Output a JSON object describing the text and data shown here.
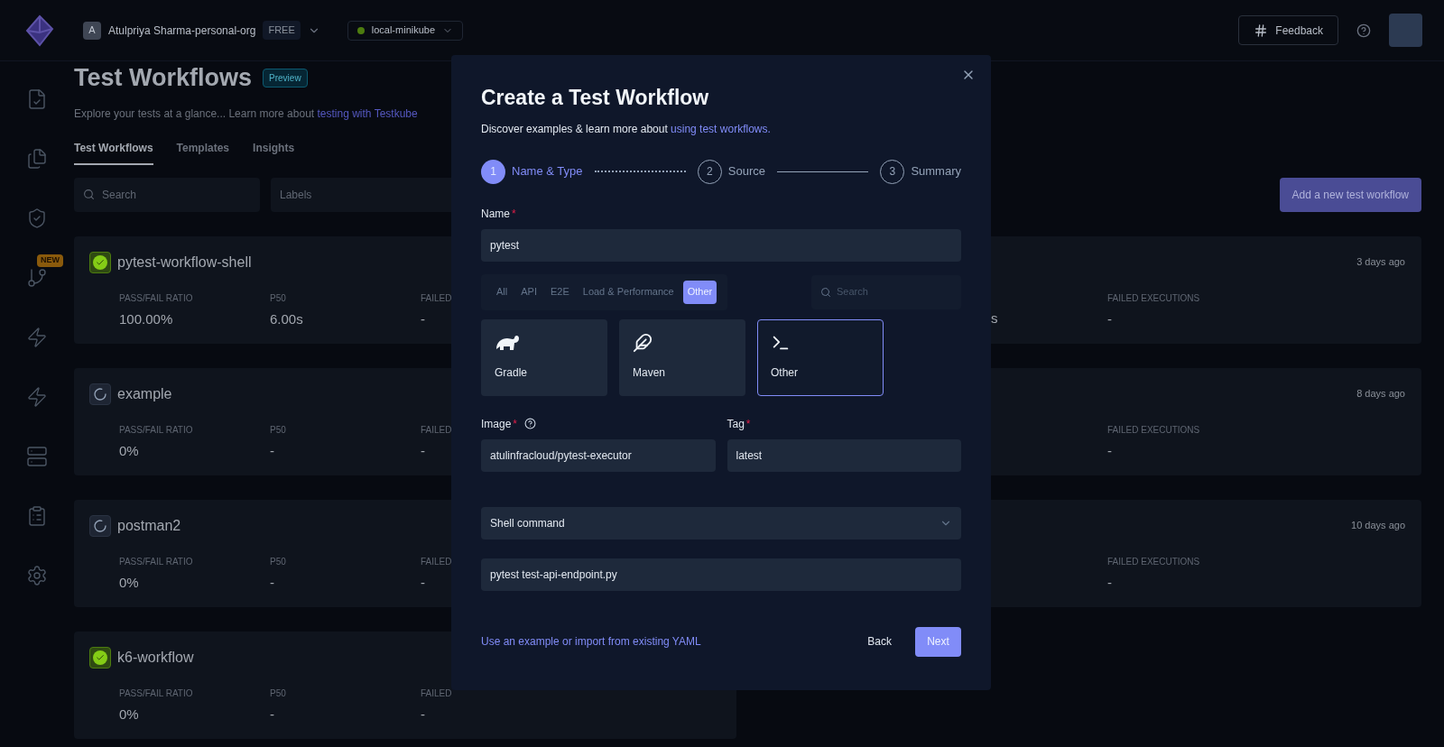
{
  "topbar": {
    "org": {
      "initial": "A",
      "name": "Atulpriya Sharma-personal-org",
      "plan": "FREE"
    },
    "environment": {
      "name": "local-minikube"
    },
    "feedback": "Feedback"
  },
  "sidebar": {
    "badge": "NEW"
  },
  "page": {
    "title": "Test Workflows",
    "badge": "Preview",
    "description": "Explore your tests at a glance... Learn more about ",
    "description_link": "testing with Testkube",
    "tabs": [
      {
        "label": "Test Workflows",
        "selected": true
      },
      {
        "label": "Templates",
        "selected": false
      },
      {
        "label": "Insights",
        "selected": false
      }
    ],
    "search": {
      "placeholder": "Search"
    },
    "labels": {
      "placeholder": "Labels"
    },
    "add_button": "Add a new test workflow",
    "workflows": [
      {
        "name": "pytest-workflow-shell",
        "kind": "passed",
        "time": "3 days ago",
        "wide": true,
        "stats": [
          {
            "label": "PASS/FAIL RATIO",
            "value": "100.00%"
          },
          {
            "label": "P50",
            "value": "6.00s"
          },
          {
            "label": "FAILED",
            "value": "-"
          }
        ],
        "stats_right": [
          {
            "kind": "partial",
            "value": "s"
          },
          {
            "kind": "stat",
            "label": "FAILED EXECUTIONS",
            "value": "-"
          }
        ]
      },
      {
        "name": "example",
        "kind": "pending",
        "time": "8 days ago",
        "wide": true,
        "stats": [
          {
            "label": "PASS/FAIL RATIO",
            "value": "0%"
          },
          {
            "label": "P50",
            "value": "-"
          },
          {
            "label": "FAILED",
            "value": "-"
          }
        ],
        "stats_right": [
          {
            "kind": "stat",
            "label": "FAILED EXECUTIONS",
            "value": "-"
          }
        ]
      },
      {
        "name": "postman2",
        "kind": "pending",
        "time": "10 days ago",
        "wide": true,
        "stats": [
          {
            "label": "PASS/FAIL RATIO",
            "value": "0%"
          },
          {
            "label": "P50",
            "value": "-"
          },
          {
            "label": "FAILED",
            "value": "-"
          }
        ],
        "stats_right": [
          {
            "kind": "stat",
            "label": "FAILED EXECUTIONS",
            "value": "-"
          }
        ]
      },
      {
        "name": "k6-workflow",
        "kind": "passed",
        "wide": false,
        "stats": [
          {
            "label": "PASS/FAIL RATIO",
            "value": "0%"
          },
          {
            "label": "P50",
            "value": "-"
          },
          {
            "label": "FAILED",
            "value": "-"
          }
        ]
      }
    ]
  },
  "modal": {
    "title": "Create a Test Workflow",
    "subtitle": "Discover examples & learn more about ",
    "subtitle_link": "using test workflows.",
    "steps": [
      {
        "number": "1",
        "label": "Name & Type",
        "selected": true
      },
      {
        "number": "2",
        "label": "Source",
        "selected": false
      },
      {
        "number": "3",
        "label": "Summary",
        "selected": false
      }
    ],
    "name_field": {
      "label": "Name",
      "required_mark": "*",
      "value": "pytest"
    },
    "filters": [
      {
        "label": "All",
        "selected": false
      },
      {
        "label": "API",
        "selected": false
      },
      {
        "label": "E2E",
        "selected": false
      },
      {
        "label": "Load & Performance",
        "selected": false
      },
      {
        "label": "Other",
        "selected": true
      }
    ],
    "type_search": {
      "placeholder": "Search"
    },
    "types": [
      {
        "kind": "gradle",
        "label": "Gradle",
        "selected": false
      },
      {
        "kind": "maven",
        "label": "Maven",
        "selected": false
      },
      {
        "kind": "other",
        "label": "Other",
        "selected": true
      }
    ],
    "image_field": {
      "label": "Image",
      "required_mark": "*",
      "value": "atulinfracloud/pytest-executor"
    },
    "tag_field": {
      "label": "Tag",
      "required_mark": "*",
      "value": "latest"
    },
    "command_select": {
      "value": "Shell command"
    },
    "command_field": {
      "value": "pytest test-api-endpoint.py"
    },
    "footer_link": "Use an example or import from existing YAML",
    "back": "Back",
    "next": "Next"
  }
}
